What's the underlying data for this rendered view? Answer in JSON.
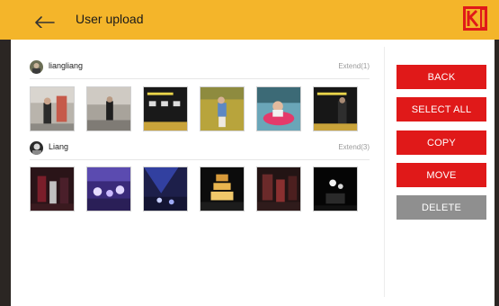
{
  "header": {
    "title": "User upload",
    "logo_letter": "K",
    "logo_brand": "KODAK",
    "background": "#f4b52a"
  },
  "groups": [
    {
      "user": "liangliang",
      "extend": "Extend(1)",
      "thumbnails": [
        "photo-man-street",
        "photo-man-street-2",
        "photo-black-wall-exhibit",
        "photo-child-grass",
        "photo-child-water-play",
        "photo-man-black-booth"
      ]
    },
    {
      "user": "Liang",
      "extend": "Extend(3)",
      "thumbnails": [
        "photo-crowd-night-red",
        "photo-crowd-stage-purple",
        "photo-stage-lights-blue",
        "photo-pagoda-lit-night",
        "photo-street-night-red",
        "photo-dark-night-lights"
      ]
    }
  ],
  "actions": {
    "back": "BACK",
    "select_all": "SELECT ALL",
    "copy": "COPY",
    "move": "MOVE",
    "delete": "DELETE"
  },
  "colors": {
    "accent": "#e01919",
    "disabled": "#8f8f8f",
    "frame": "#2b2623"
  }
}
